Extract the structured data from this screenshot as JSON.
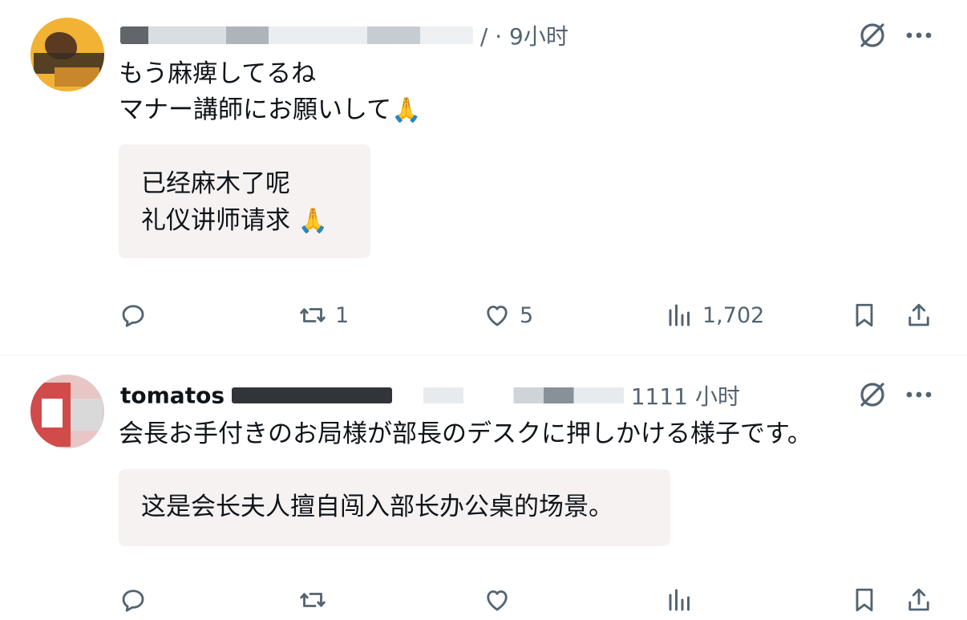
{
  "posts": [
    {
      "time": "/ · 9小时",
      "lines": [
        "もう麻痺してるね",
        "マナー講師にお願いして"
      ],
      "line2_emoji": "🙏",
      "translation": [
        "已经麻木了呢",
        "礼仪讲师请求"
      ],
      "translation_emoji": "🙏",
      "actions": {
        "reply_count": "",
        "repost_count": "1",
        "like_count": "5",
        "views_count": "1,702"
      }
    },
    {
      "handle_text": "tomatos",
      "time": "1111  小时",
      "lines": [
        "会長お手付きのお局様が部長のデスクに押しかける様子です。"
      ],
      "translation": [
        "这是会长夫人擅自闯入部长办公桌的场景。"
      ]
    }
  ],
  "icons": {
    "grok": "grok-icon",
    "more": "more-icon",
    "reply": "reply-icon",
    "repost": "repost-icon",
    "like": "heart-icon",
    "views": "views-icon",
    "bookmark": "bookmark-icon",
    "share": "share-icon"
  },
  "colors": {
    "text": "#0f1419",
    "secondary": "#536471",
    "translation_bg": "#f6f2f2"
  }
}
